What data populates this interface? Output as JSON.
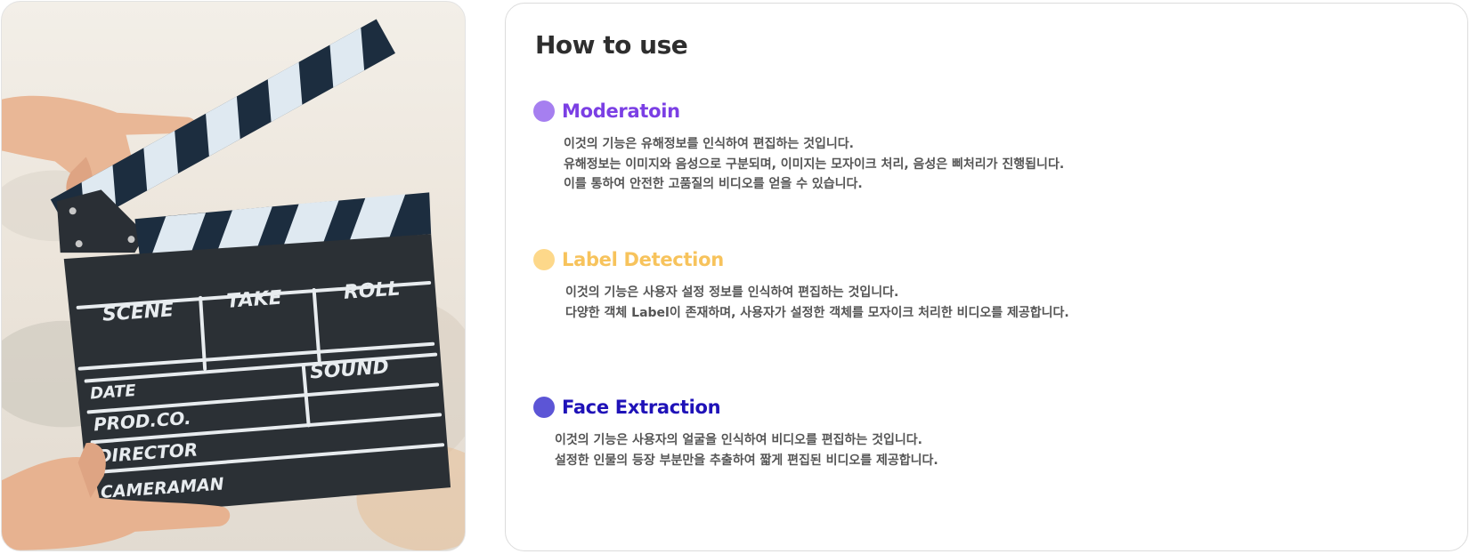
{
  "colors": {
    "moderation": "#7b3fe4",
    "moderation_dot": "#a67ff0",
    "label": "#f7c35c",
    "label_dot": "#fdd88a",
    "face": "#1f12b8",
    "face_dot": "#5c55d6"
  },
  "image": {
    "slate_labels": {
      "scene": "SCENE",
      "take": "TAKE",
      "roll": "ROLL",
      "date": "DATE",
      "sound": "SOUND",
      "prod": "PROD.CO.",
      "director": "DIRECTOR",
      "cameraman": "CAMERAMAN"
    }
  },
  "page": {
    "title": "How to use"
  },
  "sections": [
    {
      "title": "Moderatoin",
      "lines": [
        "이것의 기능은 유해정보를 인식하여 편집하는 것입니다.",
        "유해정보는 이미지와 음성으로 구분되며, 이미지는 모자이크 처리, 음성은 삐처리가 진행됩니다.",
        "이를 통하여 안전한 고품질의 비디오를 얻을 수 있습니다."
      ]
    },
    {
      "title": "Label Detection",
      "lines": [
        "이것의 기능은 사용자 설정 정보를 인식하여 편집하는 것입니다.",
        "다양한 객체 Label이 존재하며, 사용자가 설정한 객체를 모자이크 처리한 비디오를 제공합니다."
      ]
    },
    {
      "title": "Face Extraction",
      "lines": [
        "이것의 기능은 사용자의 얼굴을 인식하여 비디오를 편집하는 것입니다.",
        "설정한 인물의 등장 부분만을 추출하여 짧게 편집된 비디오를 제공합니다."
      ]
    }
  ]
}
